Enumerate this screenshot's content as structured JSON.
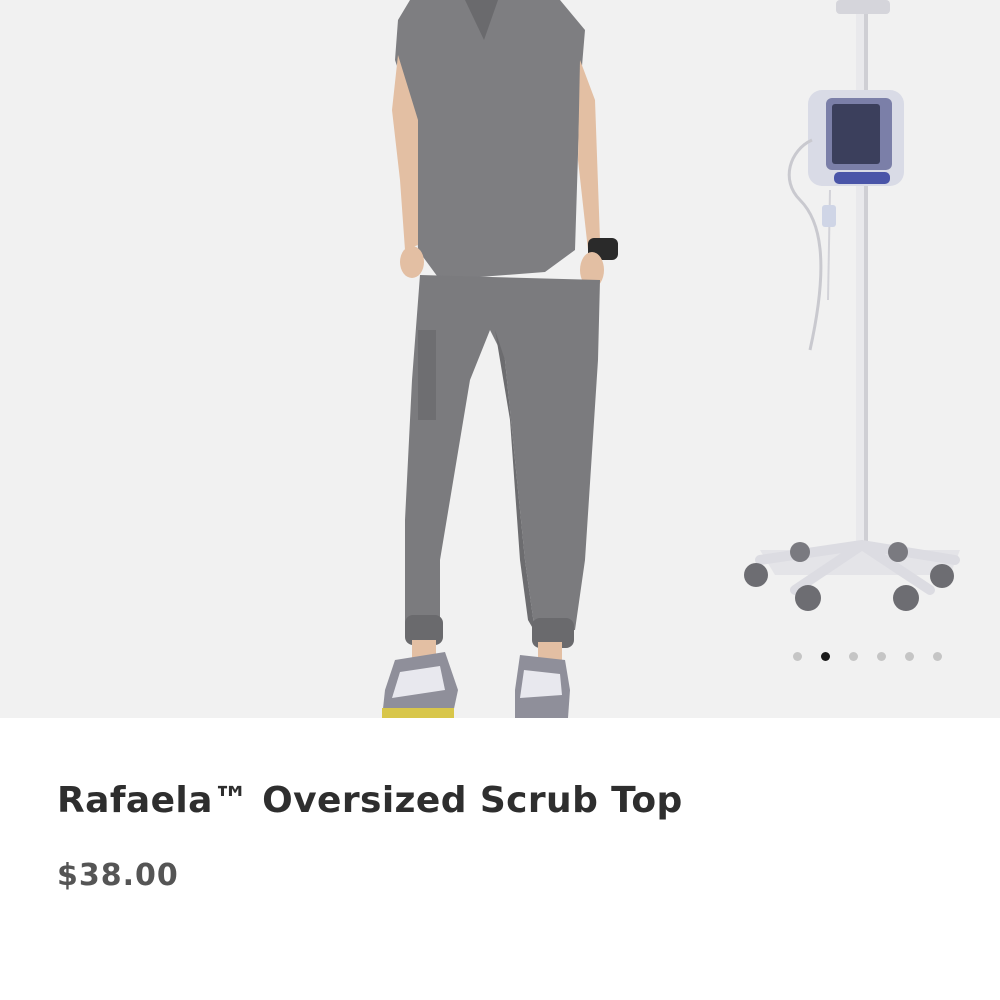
{
  "carousel": {
    "image_alt": "Rafaela Oversized Scrub Top product photo",
    "slide_count": 6,
    "active_index": 1,
    "dots": [
      "slide-1",
      "slide-2",
      "slide-3",
      "slide-4",
      "slide-5",
      "slide-6"
    ]
  },
  "product": {
    "title": "Rafaela™ Oversized Scrub Top",
    "price": "$38.00"
  },
  "colors": {
    "background": "#f1f1f1",
    "scrub_gray": "#7d7d80",
    "title_text": "#2e2e2e",
    "price_text": "#555555",
    "dot_active": "#1b1b1b",
    "dot_inactive": "#c5c5c5"
  }
}
